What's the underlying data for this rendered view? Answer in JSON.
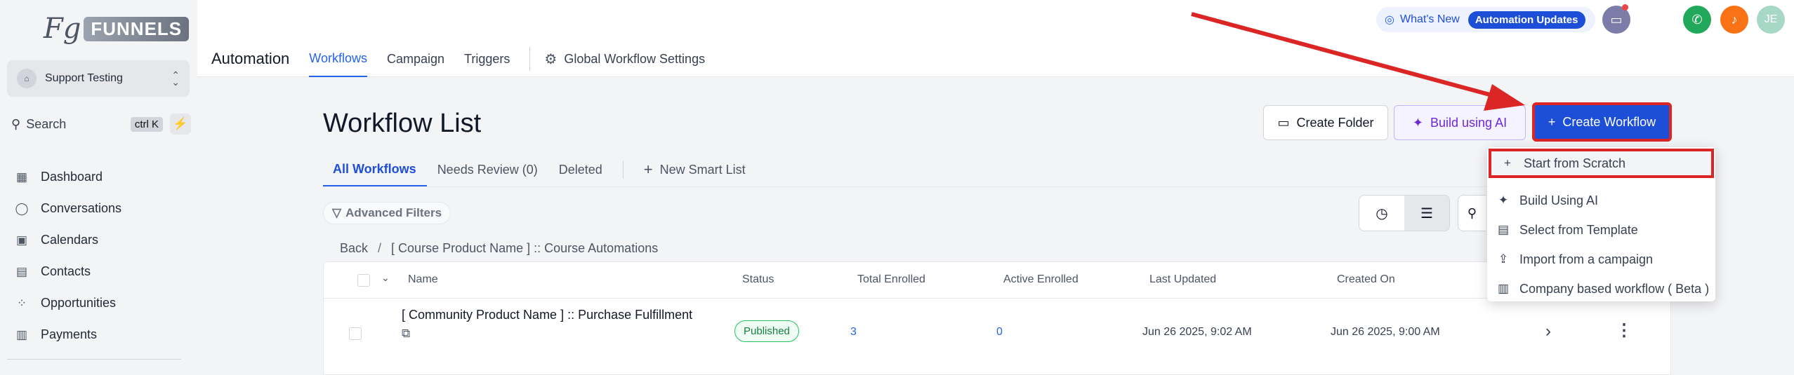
{
  "sidebar": {
    "logo_fg": "Fg",
    "logo_text": "FUNNELS",
    "location_name": "Support Testing",
    "search_label": "Search",
    "search_shortcut": "ctrl K",
    "nav_items": [
      {
        "label": "Dashboard",
        "icon": "dashboard-icon"
      },
      {
        "label": "Conversations",
        "icon": "chat-bubble-icon"
      },
      {
        "label": "Calendars",
        "icon": "calendar-icon"
      },
      {
        "label": "Contacts",
        "icon": "contacts-icon"
      },
      {
        "label": "Opportunities",
        "icon": "opportunities-icon"
      },
      {
        "label": "Payments",
        "icon": "payments-icon"
      }
    ]
  },
  "header": {
    "app_title": "Automation",
    "tabs": [
      {
        "label": "Workflows",
        "active": true
      },
      {
        "label": "Campaign",
        "active": false
      },
      {
        "label": "Triggers",
        "active": false
      }
    ],
    "global_settings": "Global Workflow Settings",
    "whats_new": "What's New",
    "automation_updates": "Automation Updates",
    "avatar_initials": "JE"
  },
  "main": {
    "title": "Workflow List",
    "create_folder": "Create Folder",
    "build_ai": "Build using AI",
    "create_workflow": "Create Workflow",
    "subtabs": [
      {
        "label": "All Workflows",
        "active": true
      },
      {
        "label": "Needs Review (0)",
        "active": false
      },
      {
        "label": "Deleted",
        "active": false
      }
    ],
    "new_smart_list": "New Smart List",
    "advanced_filters": "Advanced Filters",
    "breadcrumb": {
      "back": "Back",
      "separator": "/",
      "current": "[ Course Product Name ] :: Course Automations"
    },
    "table": {
      "columns": [
        "Name",
        "Status",
        "Total Enrolled",
        "Active Enrolled",
        "Last Updated",
        "Created On"
      ],
      "rows": [
        {
          "name": "[ Community Product Name ] :: Purchase Fulfillment",
          "status": "Published",
          "total_enrolled": "3",
          "active_enrolled": "0",
          "last_updated": "Jun 26 2025, 9:02 AM",
          "created_on": "Jun 26 2025, 9:00 AM"
        }
      ]
    }
  },
  "dropdown": {
    "items": [
      {
        "label": "Start from Scratch",
        "icon": "plus-icon"
      },
      {
        "label": "Build Using AI",
        "icon": "magic-wand-icon"
      },
      {
        "label": "Select from Template",
        "icon": "template-icon"
      },
      {
        "label": "Import from a campaign",
        "icon": "import-icon"
      },
      {
        "label": "Company based workflow ( Beta )",
        "icon": "company-icon"
      }
    ]
  },
  "colors": {
    "accent": "#1d4ed8",
    "annotation": "#dc2626",
    "ai_purple": "#6d28d9",
    "published_green": "#15803d"
  }
}
